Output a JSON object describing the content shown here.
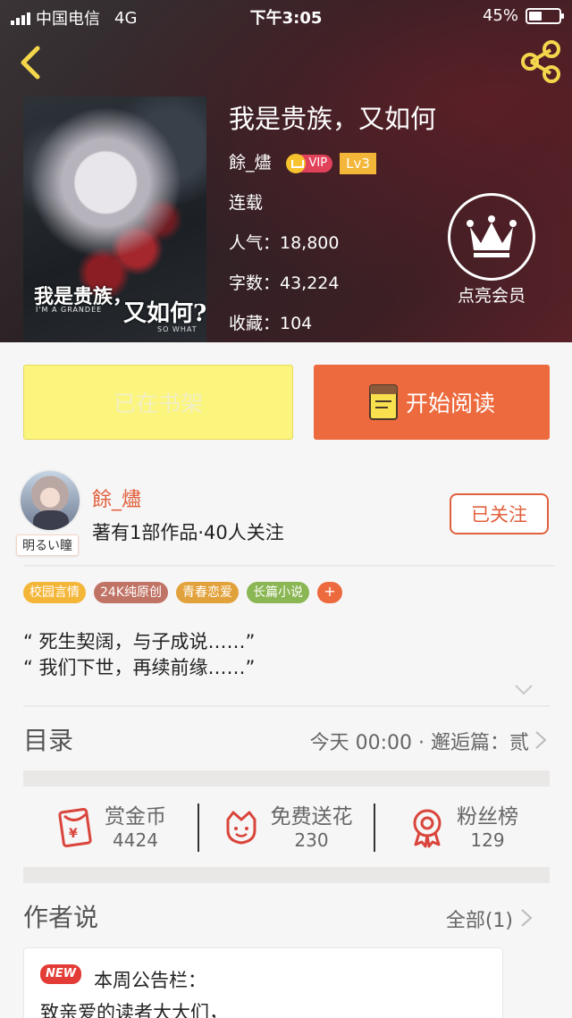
{
  "status_bar": {
    "carrier": "中国电信",
    "network": "4G",
    "time": "下午3:05",
    "battery": "45%",
    "battery_level": 0.45
  },
  "book": {
    "title": "我是贵族，又如何",
    "author": "餘_燼",
    "vip_label": "VIP",
    "level": "Lv3",
    "status": "连载",
    "popularity": "人气：18,800",
    "word_count": "字数：43,224",
    "favorites": "收藏：104"
  },
  "cover": {
    "line1": "我是贵族，",
    "line1_en": "I'M A GRANDEE",
    "line2": "又如何?",
    "line2_en": "SO WHAT"
  },
  "member": {
    "label": "点亮会员"
  },
  "actions": {
    "shelf": "已在书架",
    "read": "开始阅读"
  },
  "author": {
    "name": "餘_燼",
    "meta": "著有1部作品·40人关注",
    "follow": "已关注",
    "avatar_tag": "明るい瞳"
  },
  "tags": [
    {
      "label": "校园言情",
      "color": "#f4b638"
    },
    {
      "label": "24K纯原创",
      "color": "#c07466"
    },
    {
      "label": "青春恋爱",
      "color": "#e2a23b"
    },
    {
      "label": "长篇小说",
      "color": "#8ab653"
    }
  ],
  "tags_more": "+",
  "quotes": [
    "“ 死生契阔，与子成说……”",
    "“ 我们下世，再续前缘……”"
  ],
  "toc": {
    "title": "目录",
    "latest": "今天 00:00 · 邂逅篇：贰"
  },
  "stats": [
    {
      "label": "赏金币",
      "value": "4424",
      "icon": "red-envelope-icon"
    },
    {
      "label": "免费送花",
      "value": "230",
      "icon": "flower-icon"
    },
    {
      "label": "粉丝榜",
      "value": "129",
      "icon": "medal-icon"
    }
  ],
  "author_says": {
    "title": "作者说",
    "all": "全部(1)"
  },
  "notice": {
    "badge": "NEW",
    "title": "本周公告栏：",
    "body": "致亲爱的读者大大们，"
  },
  "colors": {
    "accent": "#ec6a3d",
    "author_red": "#e0603d",
    "shelf_yellow": "#fbf57d"
  }
}
